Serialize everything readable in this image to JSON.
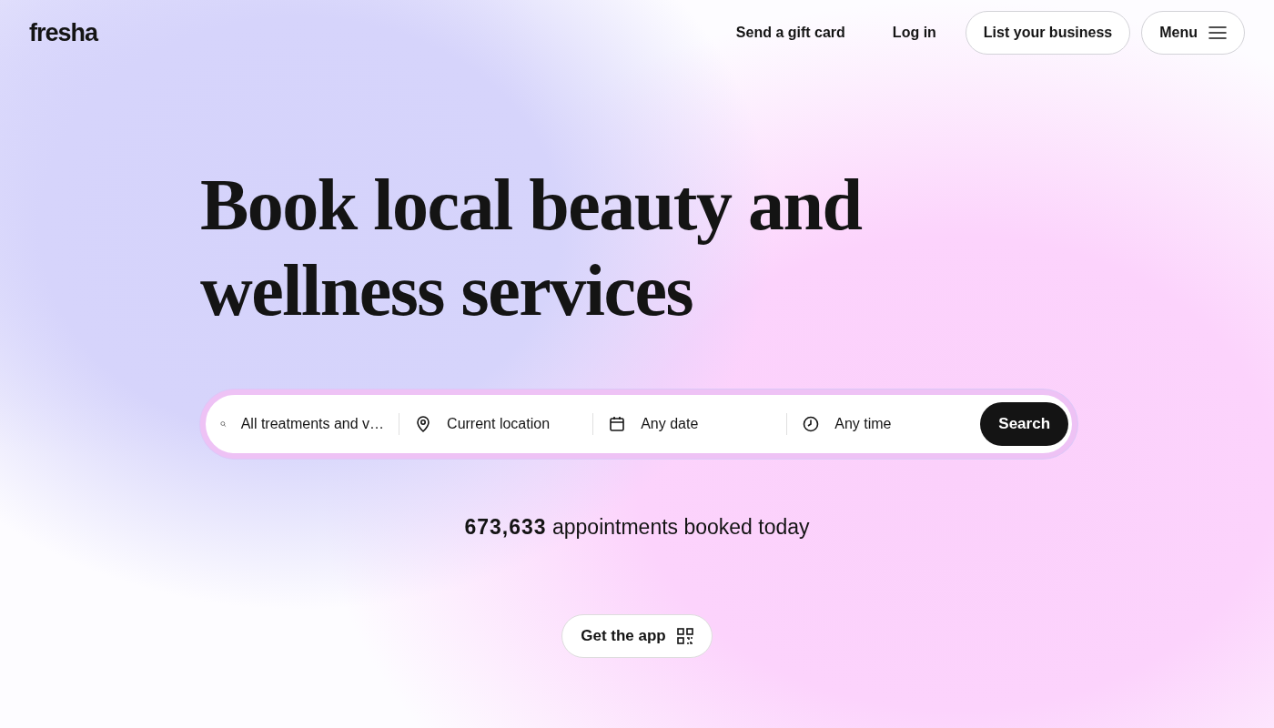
{
  "header": {
    "logo": "fresha",
    "links": [
      {
        "label": "Send a gift card",
        "kind": "link"
      },
      {
        "label": "Log in",
        "kind": "link"
      },
      {
        "label": "List your business",
        "kind": "outlined"
      },
      {
        "label": "Menu",
        "kind": "menu"
      }
    ]
  },
  "hero": {
    "title_lines": [
      "Book local beauty and",
      "wellness services"
    ],
    "search": {
      "fields": [
        {
          "kind": "search",
          "value": "All treatments and v…"
        },
        {
          "kind": "location",
          "value": "Current location"
        },
        {
          "kind": "date",
          "value": "Any date"
        },
        {
          "kind": "time",
          "value": "Any time"
        }
      ],
      "button": "Search"
    },
    "stats": "**673,633** appointments booked today",
    "app_button": "Get the app"
  }
}
